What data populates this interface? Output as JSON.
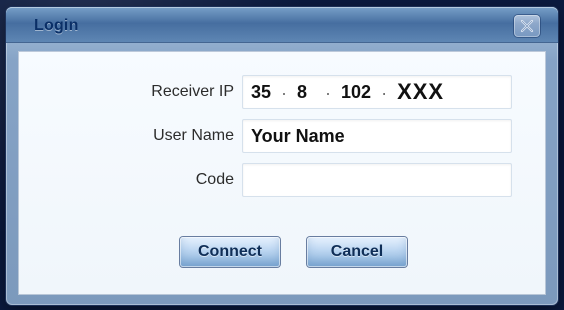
{
  "dialog": {
    "title": "Login",
    "close_icon": "close-icon"
  },
  "form": {
    "receiver_ip": {
      "label": "Receiver IP",
      "segments": [
        "35",
        "8",
        "102",
        "XXX"
      ]
    },
    "user_name": {
      "label": "User Name",
      "value": "Your Name"
    },
    "code": {
      "label": "Code",
      "value": ""
    }
  },
  "buttons": {
    "connect": "Connect",
    "cancel": "Cancel"
  }
}
